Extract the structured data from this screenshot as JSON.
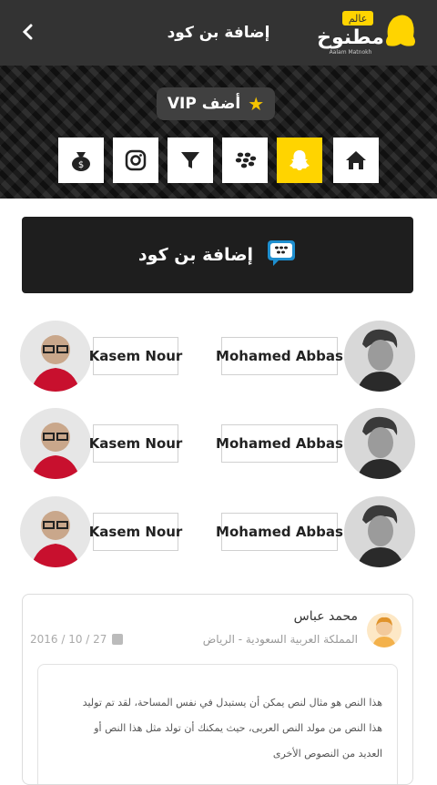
{
  "topbar": {
    "title": "إضافة بن كود",
    "logo_text": "مطنوخ",
    "logo_badge": "عالم",
    "logo_sub": "Aalam Matnokh"
  },
  "vip": {
    "label": "أضف VIP",
    "icon": "star-icon"
  },
  "icon_bar": [
    {
      "name": "money-bag-icon",
      "active": false
    },
    {
      "name": "instagram-icon",
      "active": false
    },
    {
      "name": "filter-icon",
      "active": false
    },
    {
      "name": "blackberry-icon",
      "active": false
    },
    {
      "name": "snapchat-icon",
      "active": true
    },
    {
      "name": "home-icon",
      "active": false
    }
  ],
  "banner": {
    "title": "إضافة بن كود",
    "icon": "bbm-chat-icon"
  },
  "pairs": [
    {
      "left_name": "Kasem Nour",
      "right_name": "Mohamed Abbas"
    },
    {
      "left_name": "Kasem Nour",
      "right_name": "Mohamed Abbas"
    },
    {
      "left_name": "Kasem Nour",
      "right_name": "Mohamed Abbas"
    }
  ],
  "post": {
    "author": "محمد عباس",
    "location": "المملكة العربية السعودية - الرياض",
    "date": "2016 / 10 / 27",
    "lines": [
      "هذا النص هو مثال لنص يمكن أن يستبدل في نفس المساحة، لقد تم توليد",
      "هذا النص من مولد النص العربى، حيث يمكنك أن تولد مثل هذا النص أو",
      "العديد من النصوص الأخرى"
    ]
  },
  "colors": {
    "accent": "#ffd400",
    "dark": "#333333",
    "banner": "#1e1e1e"
  }
}
